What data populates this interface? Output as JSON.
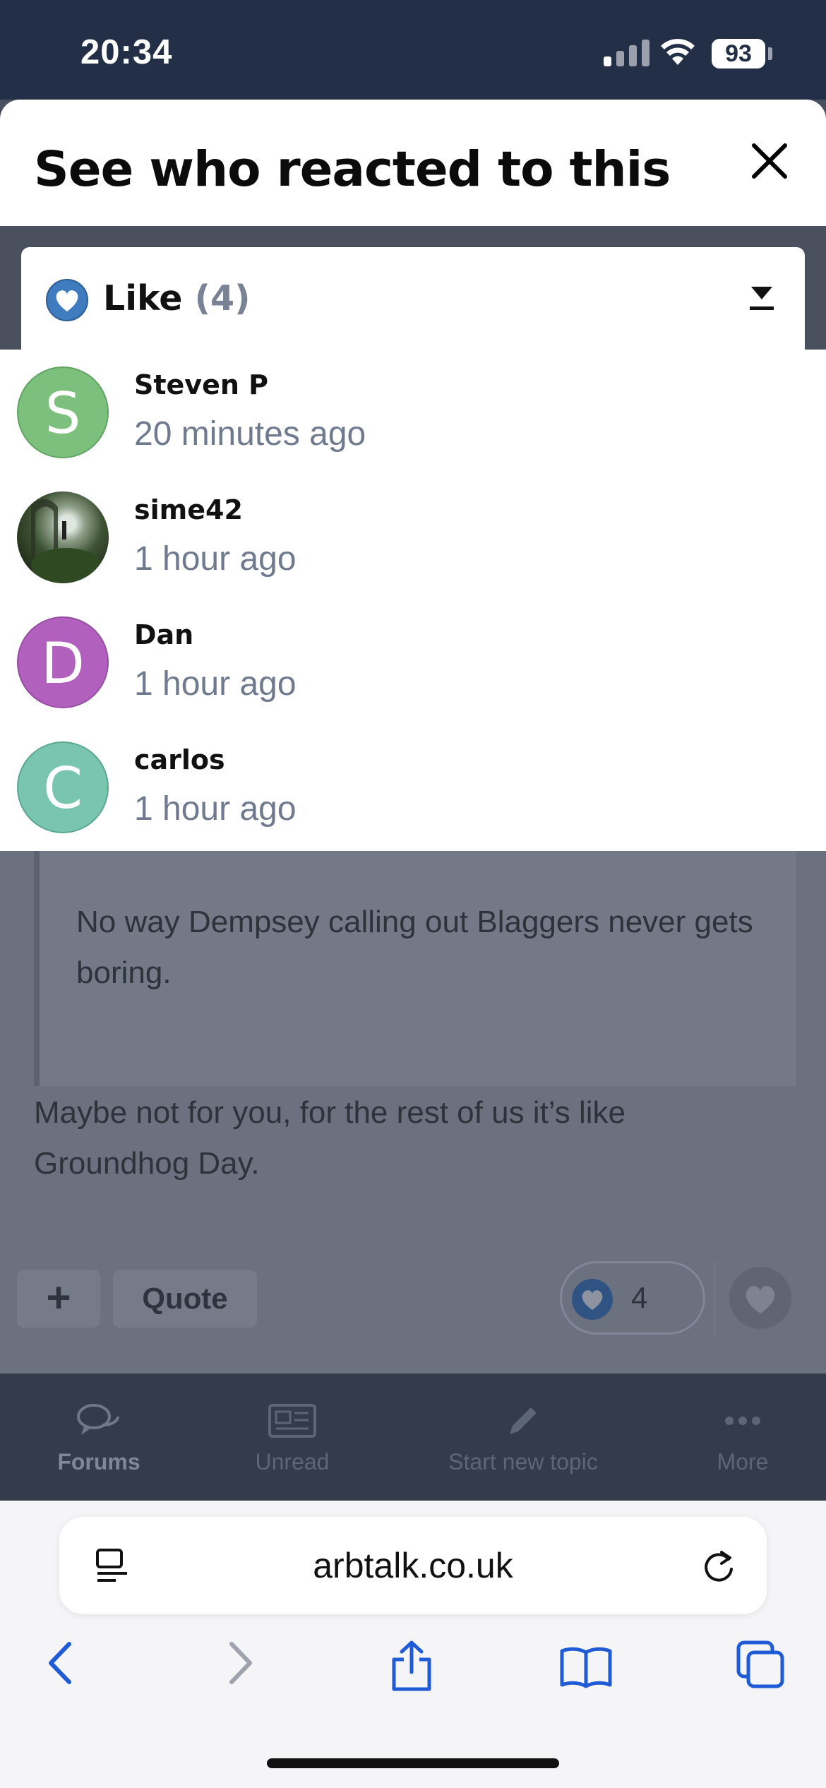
{
  "status_bar": {
    "time": "20:34",
    "battery": "93"
  },
  "modal": {
    "title": "See who reacted to this",
    "reaction_select": {
      "label": "Like",
      "count": "(4)"
    },
    "reactors": [
      {
        "name": "Steven P",
        "time": "20 minutes ago",
        "initial": "S",
        "color": "#7dc07e"
      },
      {
        "name": "sime42",
        "time": "1 hour ago",
        "initial": "",
        "color": "#3d5233"
      },
      {
        "name": "Dan",
        "time": "1 hour ago",
        "initial": "D",
        "color": "#b160bd"
      },
      {
        "name": "carlos",
        "time": "1 hour ago",
        "initial": "C",
        "color": "#79c5ad"
      }
    ]
  },
  "post": {
    "quote_text": "No way Dempsey calling out Blaggers never gets boring.",
    "body": "Maybe not for you, for the rest of us it’s like Groundhog Day.",
    "quote_button": "Quote",
    "reaction_count": "4"
  },
  "forum_nav": {
    "items": [
      {
        "label": "Forums",
        "icon": "chat-bubbles-icon"
      },
      {
        "label": "Unread",
        "icon": "newspaper-icon"
      },
      {
        "label": "Start new topic",
        "icon": "pencil-icon"
      },
      {
        "label": "More",
        "icon": "dots-icon"
      }
    ]
  },
  "browser": {
    "url": "arbtalk.co.uk"
  },
  "colors": {
    "header": "#232e47",
    "like_blue": "#3f7bbf",
    "muted_text": "#6f7a8e"
  }
}
